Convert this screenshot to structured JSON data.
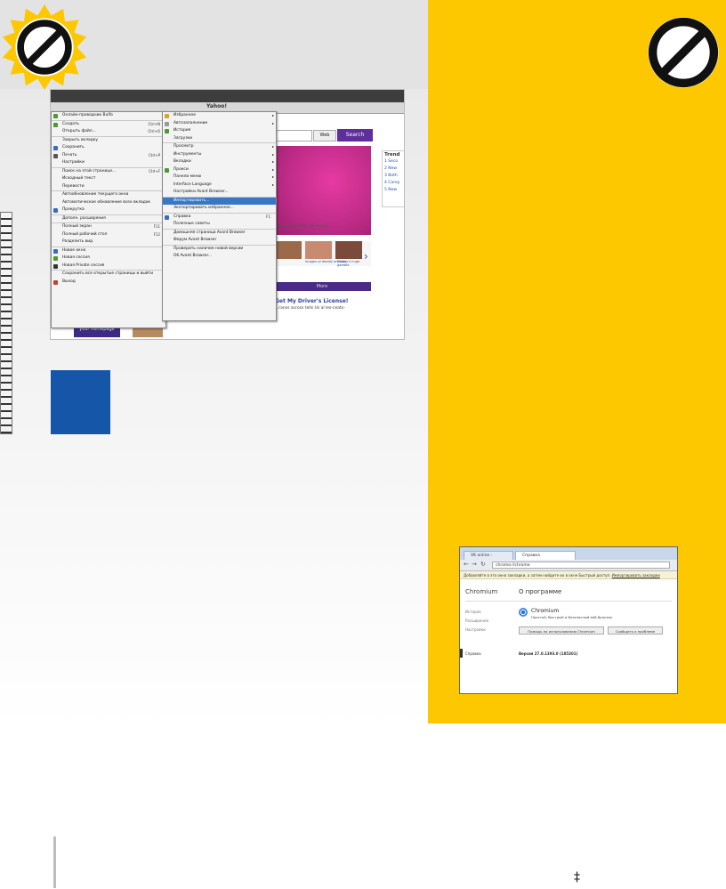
{
  "colors": {
    "panel_yellow": "#fdc800",
    "search_purple": "#5d2e9c",
    "menu_highlight": "#3877c4",
    "blue_square": "#1656a8"
  },
  "icons": {
    "top_left": "no-entry-sun-icon",
    "top_right": "no-entry-icon"
  },
  "browser": {
    "address_title": "Yahoo!",
    "web_dropdown": "Web",
    "search_button": "Search",
    "hero_caption": "...people say that's not enough",
    "thumbs": [
      "Images of deadly animals",
      "Disney's huge gamble"
    ],
    "more_strip": "More",
    "news_title": "Get My Driver's License!",
    "news_sub": "...ranss across tells Us al les-ceats-",
    "homepage_button": "your homepage",
    "trending": {
      "title": "Trend",
      "items": [
        "1 Seco",
        "2 New",
        "3 Both",
        "4 Carey",
        "5 New"
      ]
    },
    "file_menu": [
      {
        "label": "Онлайн-проводник Bulfo",
        "icon": "#4a9b2f"
      },
      {
        "label": "Создать",
        "shortcut": "Ctrl+N",
        "arrow": true,
        "sep": true,
        "icon": "#4a9b2f"
      },
      {
        "label": "Открыть файл...",
        "shortcut": "Ctrl+O"
      },
      {
        "label": "Закрыть вкладку",
        "sep": true
      },
      {
        "label": "Сохранить",
        "icon": "#3a6bc2"
      },
      {
        "label": "Печать",
        "shortcut": "Ctrl+P",
        "icon": "#555555"
      },
      {
        "label": "Настройки",
        "arrow": true
      },
      {
        "label": "Поиск на этой странице...",
        "shortcut": "Ctrl+F",
        "sep": true
      },
      {
        "label": "Исходный текст"
      },
      {
        "label": "Перевести",
        "arrow": true
      },
      {
        "label": "Автообновление текущего окна",
        "arrow": true,
        "sep": true
      },
      {
        "label": "Автоматическое обновление всех вкладок",
        "arrow": true
      },
      {
        "label": "Прокрутка",
        "arrow": true,
        "icon": "#3a6bc2"
      },
      {
        "label": "Дополн. расширения",
        "arrow": true,
        "sep": true
      },
      {
        "label": "Полный экран",
        "shortcut": "F11",
        "sep": true
      },
      {
        "label": "Полный рабочий стол",
        "shortcut": "F12"
      },
      {
        "label": "Разделить вид"
      },
      {
        "label": "Новое окно",
        "sep": true,
        "icon": "#3a6bc2"
      },
      {
        "label": "Новая сессия",
        "icon": "#4a9b2f"
      },
      {
        "label": "Новая Private сессия",
        "icon": "#333333"
      },
      {
        "label": "Сохранить все открытые страницы и выйти",
        "sep": true
      },
      {
        "label": "Выход",
        "icon": "#c2402a"
      }
    ],
    "tools_menu": [
      {
        "label": "Избранное",
        "arrow": true,
        "icon": "#d9a520"
      },
      {
        "label": "Автозаполнение",
        "arrow": true,
        "icon": "#999999"
      },
      {
        "label": "История",
        "icon": "#4a9b2f"
      },
      {
        "label": "Загрузки"
      },
      {
        "label": "Просмотр",
        "arrow": true,
        "sep": true
      },
      {
        "label": "Инструменты",
        "arrow": true
      },
      {
        "label": "Вкладки",
        "arrow": true
      },
      {
        "label": "Прокси",
        "arrow": true,
        "icon": "#4a9b2f"
      },
      {
        "label": "Панели меню",
        "arrow": true
      },
      {
        "label": "Interface Language",
        "arrow": true
      },
      {
        "label": "Настройки Avant Browser..."
      },
      {
        "label": "Импортировать...",
        "sep": true,
        "highlight": true
      },
      {
        "label": "Экспортировать избранное..."
      },
      {
        "label": "Справка",
        "shortcut": "F1",
        "sep": true,
        "icon": "#3a6bc2"
      },
      {
        "label": "Полезные советы"
      },
      {
        "label": "Домашняя страница Avant Browser",
        "sep": true
      },
      {
        "label": "Форум Avant Browser"
      },
      {
        "label": "Проверить наличие новой версии",
        "sep": true
      },
      {
        "label": "Об Avant Browser..."
      }
    ]
  },
  "chromium": {
    "tab1": "VK online - Бесплатно...",
    "tab2": "Справка",
    "omnibox": "chrome://chrome",
    "infobar": "Добавляйте в это окно закладки, а затем найдите их в окне Быстрый доступ.",
    "infobar_link": "Импортировать закладки",
    "side_title": "Chromium",
    "main_title": "О программе",
    "side_items": [
      "История",
      "Расширения",
      "Настройки"
    ],
    "side_help": "Справка",
    "product_name": "Chromium",
    "product_desc": "Простой, быстрый и безопасный веб-браузер",
    "btn_help": "Помощь по использованию Chromium",
    "btn_report": "Сообщить о проблеме",
    "version": "Версия 27.0.1393.0 (185301)"
  }
}
